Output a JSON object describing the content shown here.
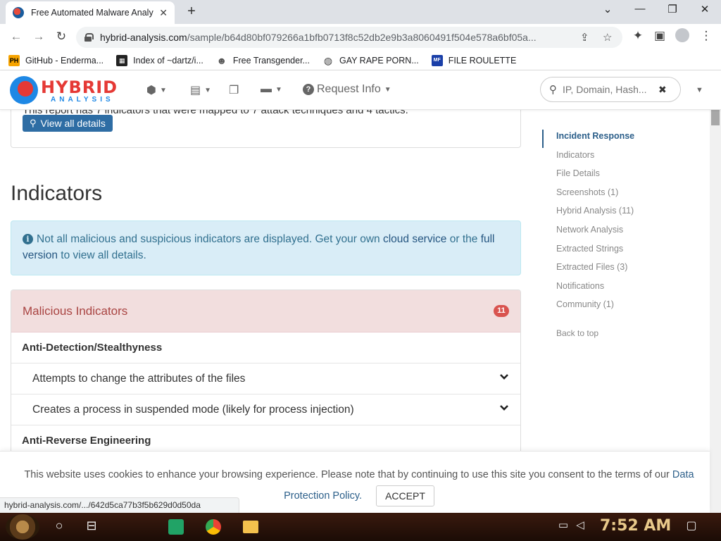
{
  "browser": {
    "tab_title": "Free Automated Malware Analy",
    "url_host": "hybrid-analysis.com",
    "url_path": "/sample/b64d80bf079266a1bfb0713f8c52db2e9b3a8060491f504e578a6bf05a...",
    "bookmarks": [
      {
        "icon_text": "PH",
        "label": "GitHub - Enderma...",
        "color": "#f7a400"
      },
      {
        "icon_text": "",
        "label": "Index of ~dartz/i...",
        "color": "#333333"
      },
      {
        "icon_text": "",
        "label": "Free Transgender...",
        "color": "#555555"
      },
      {
        "icon_text": "",
        "label": "GAY RAPE PORN...",
        "color": "#444444"
      },
      {
        "icon_text": "MF",
        "label": "FILE ROULETTE",
        "color": "#1a3fa8"
      }
    ]
  },
  "header": {
    "logo_main": "HYBRID",
    "logo_sub": "ANALYSIS",
    "request_info": "Request Info",
    "search_placeholder": "IP, Domain, Hash..."
  },
  "main": {
    "partial_text": "This report has 7 indicators that were mapped to 7 attack techniques and 4 tactics.",
    "view_details": "View all details",
    "heading": "Indicators",
    "alert": {
      "text1": "Not all malicious and suspicious indicators are displayed. Get your own",
      "link1": "cloud service",
      "text2": "or the",
      "link2": "full version",
      "text3": "to view all details."
    },
    "panel": {
      "title": "Malicious Indicators",
      "badge": "11",
      "categories": [
        {
          "name": "Anti-Detection/Stealthyness",
          "items": [
            "Attempts to change the attributes of the files",
            "Creates a process in suspended mode (likely for process injection)"
          ]
        },
        {
          "name": "Anti-Reverse Engineering",
          "items": []
        }
      ]
    }
  },
  "sidenav": {
    "items": [
      "Incident Response",
      "Indicators",
      "File Details",
      "Screenshots (1)",
      "Hybrid Analysis (11)",
      "Network Analysis",
      "Extracted Strings",
      "Extracted Files (3)",
      "Notifications",
      "Community (1)"
    ],
    "back_to_top": "Back to top"
  },
  "cookie": {
    "text": "This website uses cookies to enhance your browsing experience. Please note that by continuing to use this site you consent to the terms of our",
    "link": "Data Protection Policy.",
    "accept": "ACCEPT"
  },
  "status_link": "hybrid-analysis.com/.../642d5ca77b3f5b629d0d50da",
  "taskbar": {
    "clock": "7:52 AM"
  }
}
